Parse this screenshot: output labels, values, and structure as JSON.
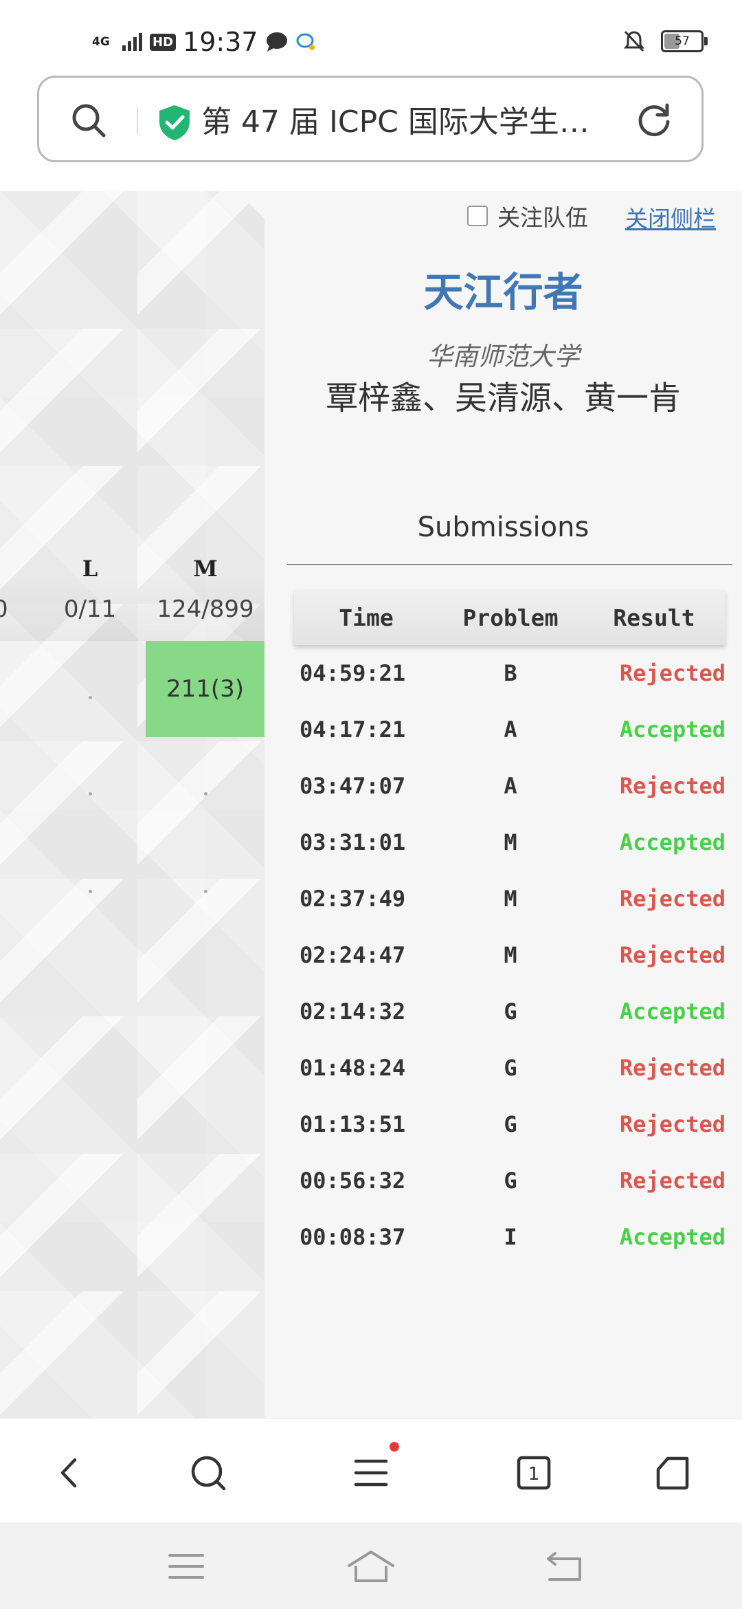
{
  "status_bar": {
    "network": "4G",
    "hd": "HD",
    "time": "19:37",
    "battery": "57"
  },
  "address_bar": {
    "title": "第 47 届 ICPC 国际大学生…"
  },
  "scoreboard": {
    "edge_fraction": "0",
    "columns": [
      {
        "label": "L",
        "stat": "0/11"
      },
      {
        "label": "M",
        "stat": "124/899"
      }
    ],
    "highlight_cell": "211(3)"
  },
  "sidebar": {
    "follow_label": "关注队伍",
    "close_label": "关闭侧栏",
    "team_name": "天江行者",
    "school": "华南师范大学",
    "members": "覃梓鑫、吴清源、黄一肯",
    "submissions_title": "Submissions",
    "headers": {
      "time": "Time",
      "problem": "Problem",
      "result": "Result"
    },
    "rows": [
      {
        "time": "04:59:21",
        "problem": "B",
        "result": "Rejected"
      },
      {
        "time": "04:17:21",
        "problem": "A",
        "result": "Accepted"
      },
      {
        "time": "03:47:07",
        "problem": "A",
        "result": "Rejected"
      },
      {
        "time": "03:31:01",
        "problem": "M",
        "result": "Accepted"
      },
      {
        "time": "02:37:49",
        "problem": "M",
        "result": "Rejected"
      },
      {
        "time": "02:24:47",
        "problem": "M",
        "result": "Rejected"
      },
      {
        "time": "02:14:32",
        "problem": "G",
        "result": "Accepted"
      },
      {
        "time": "01:48:24",
        "problem": "G",
        "result": "Rejected"
      },
      {
        "time": "01:13:51",
        "problem": "G",
        "result": "Rejected"
      },
      {
        "time": "00:56:32",
        "problem": "G",
        "result": "Rejected"
      },
      {
        "time": "00:08:37",
        "problem": "I",
        "result": "Accepted"
      }
    ]
  },
  "colors": {
    "accepted": "#47d147",
    "rejected": "#d9574f",
    "team_name": "#3f78b5",
    "solved_cell": "#87d987"
  },
  "tabs_count": "1"
}
